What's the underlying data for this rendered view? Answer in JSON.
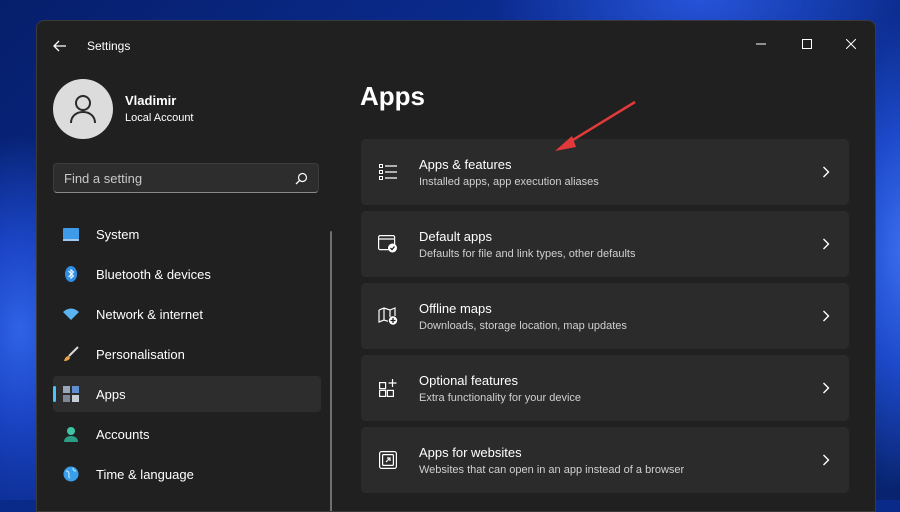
{
  "window": {
    "title": "Settings"
  },
  "user": {
    "name": "Vladimir",
    "account_type": "Local Account"
  },
  "search": {
    "placeholder": "Find a setting"
  },
  "nav": {
    "items": [
      {
        "label": "System",
        "icon": "system-icon"
      },
      {
        "label": "Bluetooth & devices",
        "icon": "bluetooth-icon"
      },
      {
        "label": "Network & internet",
        "icon": "wifi-icon"
      },
      {
        "label": "Personalisation",
        "icon": "brush-icon"
      },
      {
        "label": "Apps",
        "icon": "apps-icon",
        "active": true
      },
      {
        "label": "Accounts",
        "icon": "accounts-icon"
      },
      {
        "label": "Time & language",
        "icon": "globe-icon"
      }
    ]
  },
  "page": {
    "title": "Apps"
  },
  "cards": [
    {
      "title": "Apps & features",
      "subtitle": "Installed apps, app execution aliases",
      "icon": "list-icon"
    },
    {
      "title": "Default apps",
      "subtitle": "Defaults for file and link types, other defaults",
      "icon": "default-apps-icon"
    },
    {
      "title": "Offline maps",
      "subtitle": "Downloads, storage location, map updates",
      "icon": "map-icon"
    },
    {
      "title": "Optional features",
      "subtitle": "Extra functionality for your device",
      "icon": "optional-features-icon"
    },
    {
      "title": "Apps for websites",
      "subtitle": "Websites that can open in an app instead of a browser",
      "icon": "apps-for-websites-icon"
    }
  ],
  "colors": {
    "accent": "#4cc2ff",
    "annotation_arrow": "#e23a3a",
    "window_bg": "#202020",
    "card_bg": "#2b2b2b"
  }
}
